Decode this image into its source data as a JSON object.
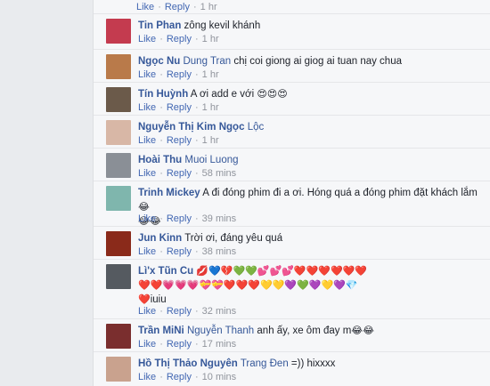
{
  "actions": {
    "like": "Like",
    "reply": "Reply",
    "dot": "·"
  },
  "first": {
    "time": "1 hr"
  },
  "comments": [
    {
      "name": "Tin Phan",
      "text": " zông kevil khánh",
      "time": "1 hr",
      "avatar": "#c43b4f"
    },
    {
      "name": "Ngọc Nu",
      "tag": "Dung Tran",
      "text": " chị coi giong ai giog ai tuan nay chua",
      "time": "1 hr",
      "avatar": "#b97a4a"
    },
    {
      "name": "Tín Huỳnh",
      "text": " A ơi add e với ",
      "emoji": "😍😍😍",
      "time": "1 hr",
      "avatar": "#6b5a4a"
    },
    {
      "name": "Nguyễn Thị Kim Ngọc",
      "tag": "Lộc",
      "text": "",
      "time": "1 hr",
      "avatar": "#d8b7a6"
    },
    {
      "name": "Hoài Thu",
      "tag": "Muoi Luong",
      "text": "",
      "time": "58 mins",
      "avatar": "#8a8f96"
    },
    {
      "name": "Trinh Mickey",
      "text": " A đi đóng phim đi a ơi. Hóng quá a đóng phim đặt khách lắm",
      "emoji": "😂",
      "emoji2": "😂😂",
      "time": "39 mins",
      "avatar": "#7fb6ad"
    },
    {
      "name": "Jun Kinn",
      "text": " Trời ơi, đáng yêu quá",
      "time": "38 mins",
      "avatar": "#8a2a1a"
    },
    {
      "name": "Lì'x Tũn Cu",
      "hearts1": "💋💙💔💚💚💕💕💕❤️❤️❤️❤️❤️❤️",
      "hearts2": "❤️❤️💗💗💗💝💝❤️❤️❤️💛💛💜💚💜💛💜💎",
      "tail": "iuiu",
      "heart3": "❤️",
      "time": "32 mins",
      "avatar": "#555a60"
    },
    {
      "name": "Trần MiNi",
      "tag": "Nguyễn Thanh",
      "text": " anh ấy, xe ôm đay m",
      "emoji": "😂😂",
      "time": "17 mins",
      "avatar": "#7a2e2e"
    },
    {
      "name": "Hồ Thị Thảo Nguyên",
      "tag": "Trang Đen",
      "text": " =)) hixxxx",
      "time": "10 mins",
      "avatar": "#c9a28e"
    }
  ]
}
